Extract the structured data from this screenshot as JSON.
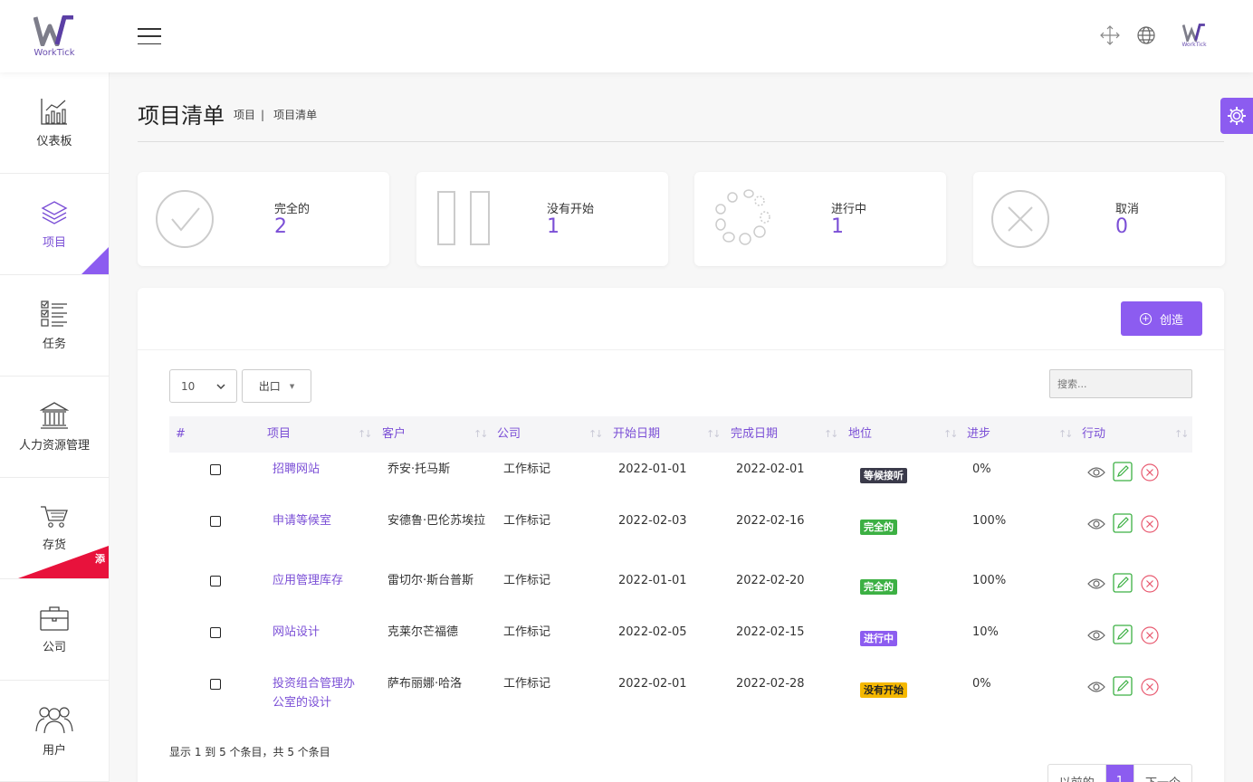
{
  "app": {
    "logo_text": "WorkTick",
    "small_logo_text": "WorkTick"
  },
  "topbar": {
    "menu_icon": "hamburger-icon",
    "move_icon": "move-arrows-icon",
    "language_icon": "globe-icon"
  },
  "sidebar": {
    "items": [
      {
        "label": "仪表板",
        "icon": "chart-icon"
      },
      {
        "label": "项目",
        "icon": "layers-icon",
        "active": true
      },
      {
        "label": "任务",
        "icon": "checklist-icon"
      },
      {
        "label": "人力资源管理",
        "icon": "bank-icon"
      },
      {
        "label": "存货",
        "icon": "cart-icon",
        "ribbon": "添"
      },
      {
        "label": "公司",
        "icon": "briefcase-icon"
      },
      {
        "label": "用户",
        "icon": "users-icon"
      }
    ]
  },
  "page": {
    "title": "项目清单",
    "breadcrumb": [
      "项目",
      "|",
      "项目清单"
    ]
  },
  "stats": [
    {
      "label": "完全的",
      "value": "2",
      "icon": "check-circle-icon"
    },
    {
      "label": "没有开始",
      "value": "1",
      "icon": "pause-icon"
    },
    {
      "label": "进行中",
      "value": "1",
      "icon": "spinner-icon"
    },
    {
      "label": "取消",
      "value": "0",
      "icon": "x-circle-icon"
    }
  ],
  "toolbar": {
    "create_label": "创造",
    "page_length": "10",
    "export_label": "出口",
    "search_placeholder": "搜索..."
  },
  "table": {
    "columns": [
      "#",
      "项目",
      "客户",
      "公司",
      "开始日期",
      "完成日期",
      "地位",
      "进步",
      "行动"
    ],
    "rows": [
      {
        "project": "招聘网站",
        "client": "乔安·托马斯",
        "company": "工作标记",
        "start": "2022-01-01",
        "end": "2022-02-01",
        "status": "等候接听",
        "status_color": "#3a3a4a",
        "progress": "0%"
      },
      {
        "project": "申请等候室",
        "client": "安德鲁·巴伦苏埃拉",
        "company": "工作标记",
        "start": "2022-02-03",
        "end": "2022-02-16",
        "status": "完全的",
        "status_color": "#3cb043",
        "progress": "100%"
      },
      {
        "project": "应用管理库存",
        "client": "雷切尔·斯台普斯",
        "company": "工作标记",
        "start": "2022-01-01",
        "end": "2022-02-20",
        "status": "完全的",
        "status_color": "#3cb043",
        "progress": "100%"
      },
      {
        "project": "网站设计",
        "client": "克莱尔芒福德",
        "company": "工作标记",
        "start": "2022-02-05",
        "end": "2022-02-15",
        "status": "进行中",
        "status_color": "#8c5cf0",
        "progress": "10%"
      },
      {
        "project": "投资组合管理办公室的设计",
        "client": "萨布丽娜·哈洛",
        "company": "工作标记",
        "start": "2022-02-01",
        "end": "2022-02-28",
        "status": "没有开始",
        "status_color": "#f5b800",
        "status_text_color": "#222",
        "progress": "0%"
      }
    ]
  },
  "footer": {
    "info": "显示 1 到 5 个条目，共 5 个条目",
    "prev": "以前的",
    "current": "1",
    "next": "下一个"
  },
  "colors": {
    "accent": "#8c5cf0",
    "sidebar_ribbon": "#e8123c"
  }
}
